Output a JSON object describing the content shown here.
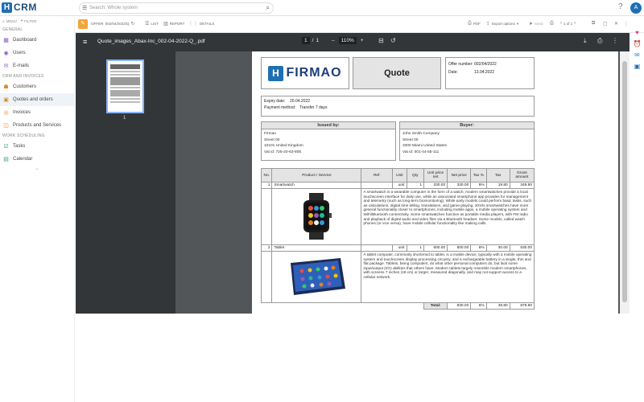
{
  "app": {
    "logo_letter": "H",
    "name": "CRM"
  },
  "search": {
    "placeholder": "Search: Whole system"
  },
  "header": {
    "help": "?",
    "avatar": "A"
  },
  "sidebar": {
    "menu": "MENU",
    "filter": "FILTER",
    "sections": [
      "GENERAL",
      "CRM AND INVOICES",
      "WORK SCHEDULING"
    ],
    "items": [
      {
        "label": "Dashboard",
        "icon": "grid-icon"
      },
      {
        "label": "Users",
        "icon": "user-icon"
      },
      {
        "label": "E-mails",
        "icon": "mail-icon"
      },
      {
        "label": "Customers",
        "icon": "customers-icon"
      },
      {
        "label": "Quotes and orders",
        "icon": "quote-icon"
      },
      {
        "label": "Invoices",
        "icon": "invoice-icon"
      },
      {
        "label": "Products and Services",
        "icon": "product-icon"
      },
      {
        "label": "Tasks",
        "icon": "tasks-icon"
      },
      {
        "label": "Calendar",
        "icon": "calendar-icon"
      }
    ]
  },
  "toolbar": {
    "offer": "OFFER: 002/04/2022/Q",
    "list": "LIST",
    "report": "REPORT",
    "details": "DETAILS",
    "pdf": "PDF",
    "export": "Export options",
    "send": "Send",
    "pager": "1 of 1"
  },
  "viewer": {
    "filename": "Quote_images_Abax-Inc_002-04-2022-Q_.pdf",
    "page_current": "1",
    "page_sep": "/",
    "page_total": "1",
    "zoom": "110%",
    "minus": "–",
    "plus": "+",
    "thumb_label": "1"
  },
  "doc": {
    "brand": "FIRMAO",
    "title": "Quote",
    "offer_number_label": "Offer number:",
    "offer_number": "002/04/2022",
    "date_label": "Date:",
    "date": "13.04.2022",
    "expiry_label": "Expiry date:",
    "expiry": "20.04.2022",
    "payment_label": "Payment method:",
    "payment": "Transfer 7 days",
    "issued_by_label": "Issued by:",
    "issued_by": [
      "Firmao",
      "Street 00",
      "10101 United Kingdom",
      "Vat id: 725-20-63-805"
    ],
    "buyer_label": "Buyer:",
    "buyer": [
      "John Smith Company",
      "Street 00",
      "3300 Miami United States",
      "Vat id: 001-44-55-111"
    ],
    "columns": [
      "No.",
      "Product / Service",
      "Ref.",
      "Unit",
      "Qty",
      "Unit price net",
      "Net price",
      "Tax %",
      "Tax",
      "Gross amount"
    ],
    "items": [
      {
        "no": "1",
        "name": "Smartwatch",
        "ref": "",
        "unit": "unit",
        "qty": "1",
        "unit_price": "330.00",
        "net": "330.00",
        "tax_pct": "6%",
        "tax": "19.80",
        "gross": "349.80",
        "desc": "A smartwatch is a wearable computer in the form of a watch; modern smartwatches provide a local touchscreen interface for daily use, while an associated smartphone app provides for management and telemetry (such as long-term biomonitoring). While early models could perform basic tasks, such as calculations, digital time telling, translations, and game-playing, 2010s smartwatches have more general functionality closer to smartphones, including mobile apps, a mobile operating system and WiFi/Bluetooth connectivity. Some smartwatches function as portable media players, with FM radio and playback of digital audio and video files via a Bluetooth headset. Some models, called watch phones (or vice versa), have mobile cellular functionality like making calls."
      },
      {
        "no": "2",
        "name": "Tablet",
        "ref": "",
        "unit": "unit",
        "qty": "1",
        "unit_price": "500.00",
        "net": "500.00",
        "tax_pct": "6%",
        "tax": "30.00",
        "gross": "530.00",
        "desc": "A tablet computer, commonly shortened to tablet, is a mobile device, typically with a mobile operating system and touchscreen display processing circuitry, and a rechargeable battery in a single, thin and flat package. Tablets, being computers, do what other personal computers do, but lack some input/output (I/O) abilities that others have. Modern tablets largely resemble modern smartphones, with screens 7 inches (18 cm) or larger, measured diagonally, and may not support access to a cellular network."
      }
    ],
    "total_label": "Total:",
    "total_net": "830.00",
    "total_tax_pct": "6%",
    "total_tax": "49.80",
    "total_gross": "879.80"
  }
}
